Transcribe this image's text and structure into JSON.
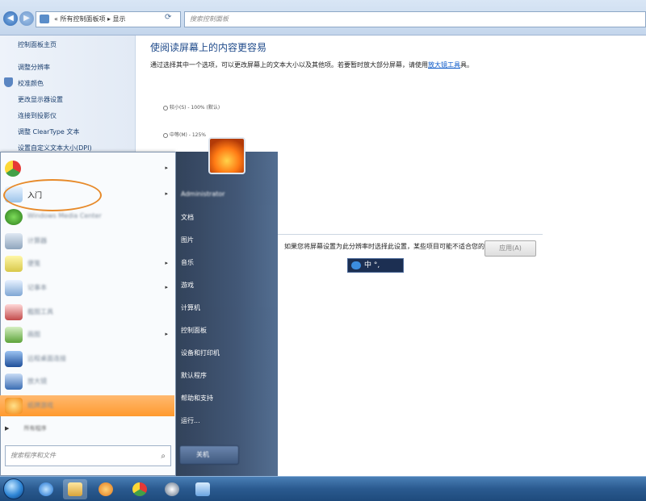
{
  "window": {
    "breadcrumb": "所有控制面板项 ▸ 显示",
    "breadcrumb_prefix": "«",
    "search_placeholder": "搜索控制面板"
  },
  "left_pane": {
    "home": "控制面板主页",
    "links": [
      "调整分辨率",
      "校准颜色",
      "更改显示器设置",
      "连接到投影仪",
      "调整 ClearType 文本",
      "设置自定义文本大小(DPI)"
    ]
  },
  "content": {
    "title": "使阅读屏幕上的内容更容易",
    "description": "通过选择其中一个选项，可以更改屏幕上的文本大小以及其他项。若要暂时放大部分屏幕，请使用",
    "magnifier_link": "放大镜工具",
    "description_end": "具。",
    "option_small": "较小(S) - 100% (默认)",
    "option_medium": "中等(M) - 125%",
    "warning": "某些项目可能不适合您的屏幕。",
    "warning_prefix": "如果您将屏幕设置为此分辨率时选择此设置，",
    "apply_label": "应用(A)",
    "ime_label": "中 °,"
  },
  "start_menu": {
    "left_items": [
      {
        "label": "",
        "arrow": true,
        "icon": "chrome-icon"
      },
      {
        "label": "入门",
        "arrow": true,
        "icon": "getting-started-icon"
      },
      {
        "label": "Windows Media Center",
        "arrow": false,
        "icon": "media-center-icon"
      },
      {
        "label": "计算器",
        "arrow": false,
        "icon": "calculator-icon"
      },
      {
        "label": "便笺",
        "arrow": true,
        "icon": "sticky-notes-icon"
      },
      {
        "label": "记事本",
        "arrow": true,
        "icon": "notepad-icon"
      },
      {
        "label": "截图工具",
        "arrow": false,
        "icon": "snipping-tool-icon"
      },
      {
        "label": "画图",
        "arrow": true,
        "icon": "paint-icon"
      },
      {
        "label": "远程桌面连接",
        "arrow": false,
        "icon": "remote-desktop-icon"
      },
      {
        "label": "放大镜",
        "arrow": false,
        "icon": "magnifier-icon"
      },
      {
        "label": "纸牌游戏",
        "arrow": false,
        "icon": "solitaire-icon"
      }
    ],
    "all_programs": "所有程序",
    "search_placeholder": "搜索程序和文件",
    "right_items": [
      {
        "label": "Administrator",
        "blur": true
      },
      {
        "label": "文档"
      },
      {
        "label": "图片"
      },
      {
        "label": "音乐"
      },
      {
        "label": "游戏"
      },
      {
        "label": "计算机"
      },
      {
        "label": "控制面板"
      },
      {
        "label": "设备和打印机"
      },
      {
        "label": "默认程序"
      },
      {
        "label": "帮助和支持"
      },
      {
        "label": "运行..."
      }
    ],
    "shutdown_label": "关机"
  },
  "taskbar": {
    "buttons": [
      "ie-icon",
      "explorer-icon",
      "media-player-icon",
      "chrome-icon",
      "qq-icon",
      "network-icon"
    ]
  },
  "colors": {
    "start_highlight": "#ff9a2e",
    "annotation_ring": "#e78a2a",
    "link": "#0a58c8"
  }
}
